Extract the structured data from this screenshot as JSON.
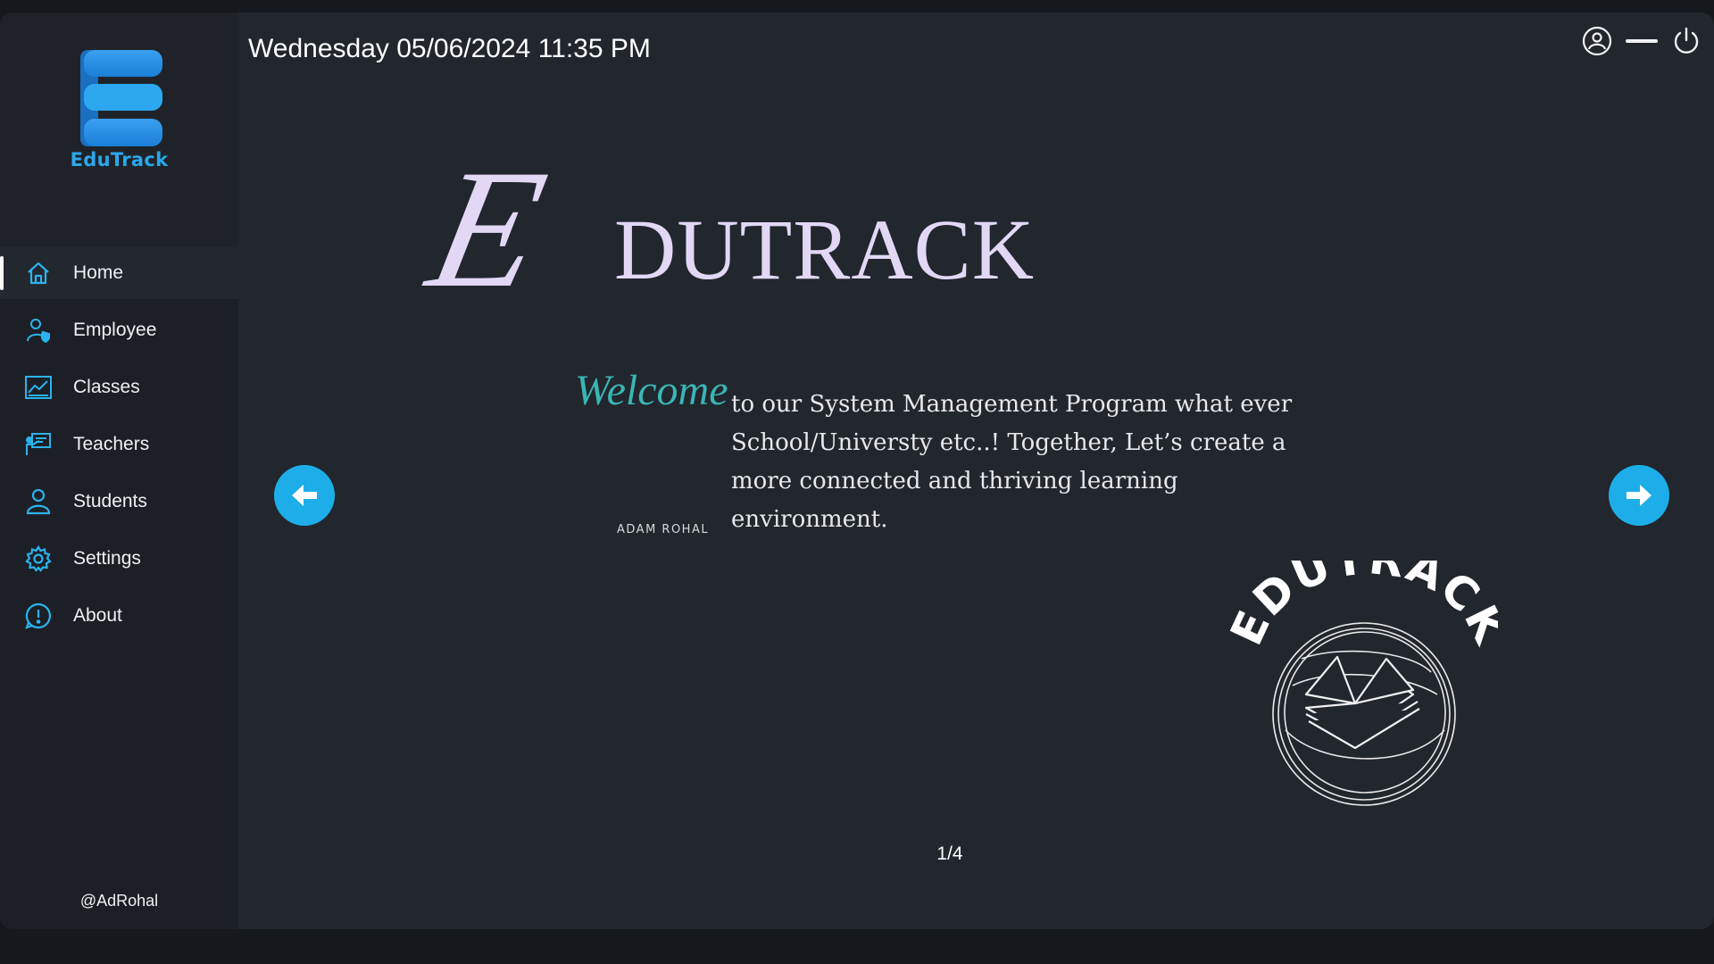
{
  "app": {
    "name": "EduTrack",
    "handle": "@AdRohal"
  },
  "header": {
    "datetime": "Wednesday 05/06/2024 11:35 PM"
  },
  "sidebar": {
    "items": [
      {
        "label": "Home",
        "icon": "home-icon",
        "active": true
      },
      {
        "label": "Employee",
        "icon": "employee-icon"
      },
      {
        "label": "Classes",
        "icon": "chart-icon"
      },
      {
        "label": "Teachers",
        "icon": "teacher-board-icon"
      },
      {
        "label": "Students",
        "icon": "student-icon"
      },
      {
        "label": "Settings",
        "icon": "gear-icon"
      },
      {
        "label": "About",
        "icon": "info-icon"
      }
    ]
  },
  "top_icons": [
    "user-circle-icon",
    "minimize-icon",
    "power-icon"
  ],
  "hero": {
    "initial": "E",
    "word": "DUTRACK",
    "welcome_script": "Welcome",
    "quote": "to our System Management Program what ever School/Universty etc..!  Together, Let’s create a more connected and thriving learning environment.",
    "author": "ADAM ROHAL",
    "seal_text": "EDUTRACK"
  },
  "carousel": {
    "page": "1/4",
    "prev_icon": "arrow-left-icon",
    "next_icon": "arrow-right-icon"
  },
  "colors": {
    "accent": "#1daee9",
    "hero": "#e2d8f6",
    "welcome": "#3ab5b4",
    "background": "#22262d",
    "sidebar": "#1c2026"
  }
}
